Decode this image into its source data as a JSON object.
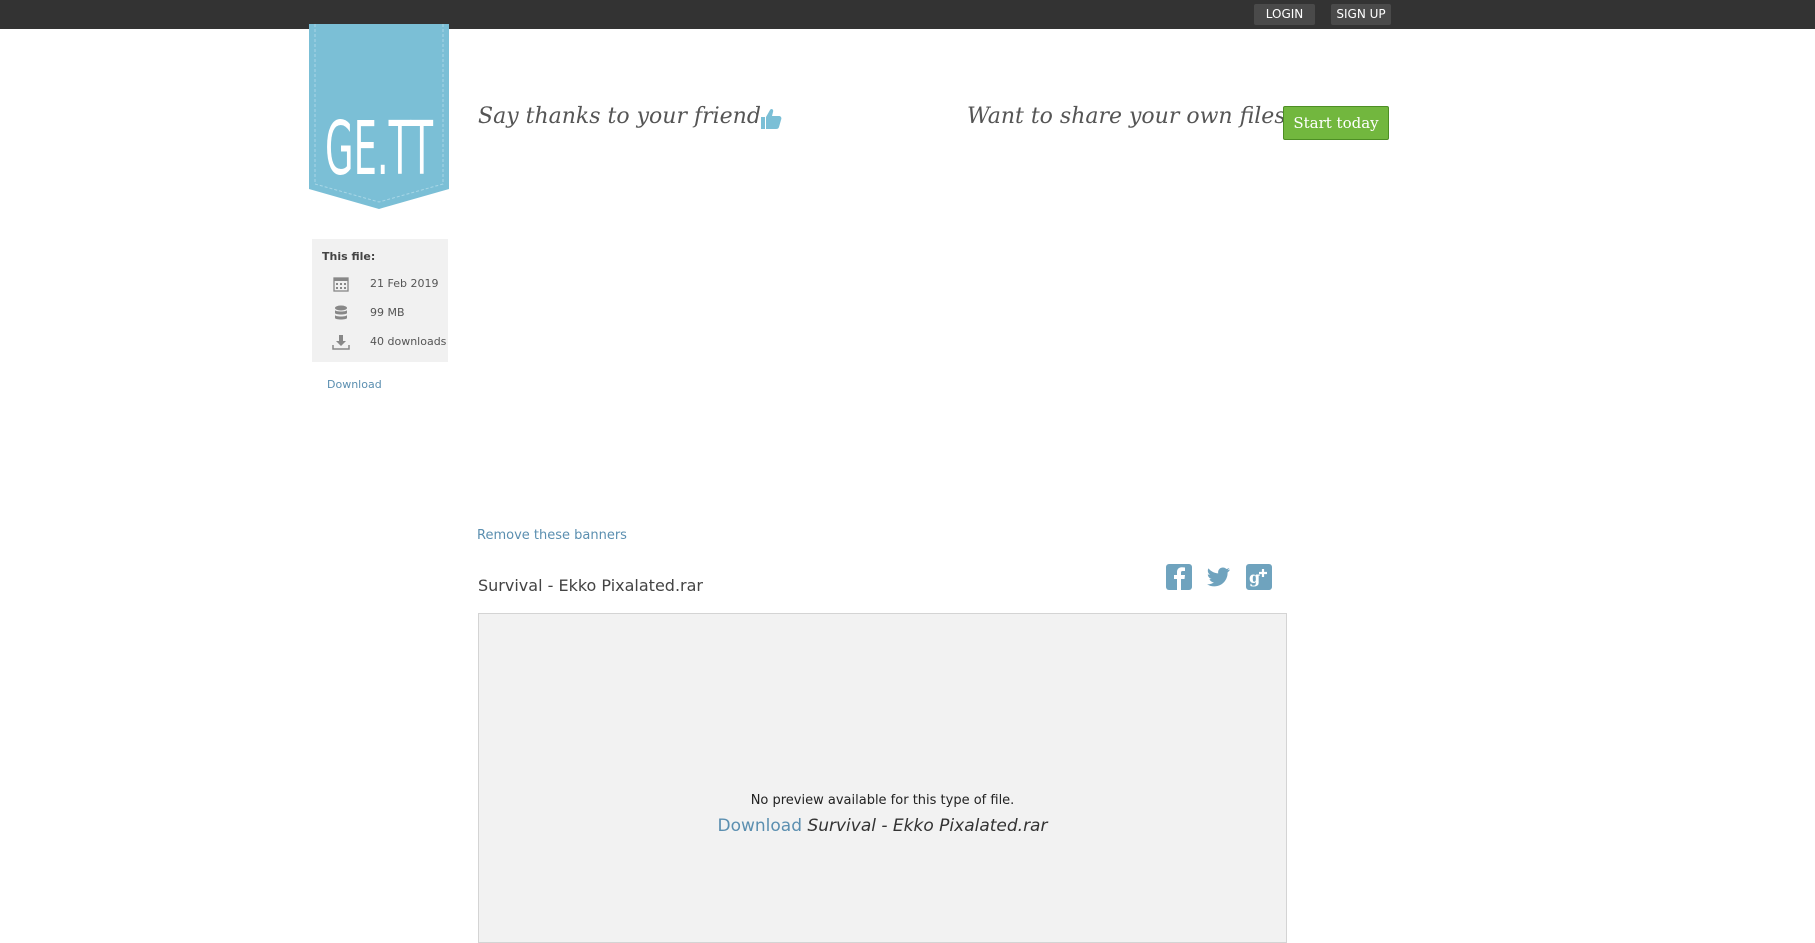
{
  "topbar": {
    "login_label": "LOGIN",
    "signup_label": "SIGN UP"
  },
  "logo": {
    "text": "GE.TT",
    "color": "#7bbfd6"
  },
  "header": {
    "thanks_text": "Say thanks to your friend",
    "share_prompt": "Want to share your own files?",
    "start_label": "Start today"
  },
  "file_info": {
    "title": "This file:",
    "date": "21 Feb 2019",
    "size": "99 MB",
    "downloads": "40 downloads",
    "download_link": "Download"
  },
  "banners": {
    "remove_label": "Remove these banners"
  },
  "file": {
    "name": "Survival - Ekko Pixalated.rar",
    "no_preview": "No preview available for this type of file.",
    "download_label": "Download",
    "download_name": "Survival - Ekko Pixalated.rar"
  },
  "icons": {
    "thumbs_up": "thumbs-up-icon",
    "calendar": "calendar-icon",
    "database": "database-icon",
    "download": "download-icon",
    "facebook": "facebook-icon",
    "twitter": "twitter-icon",
    "googleplus": "google-plus-icon"
  },
  "colors": {
    "accent": "#7bbfd6",
    "link": "#5b8fb0",
    "button_green": "#72b73e",
    "topbar": "#333333"
  }
}
